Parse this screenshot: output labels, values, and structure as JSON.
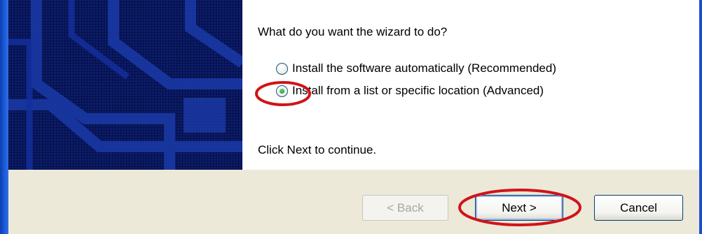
{
  "wizard": {
    "prompt": "What do you want the wizard to do?",
    "options": [
      {
        "label": "Install the software automatically (Recommended)",
        "checked": false
      },
      {
        "label": "Install from a list or specific location (Advanced)",
        "checked": true
      }
    ],
    "continue_text": "Click Next to continue."
  },
  "buttons": {
    "back_label": "< Back",
    "next_label": "Next >",
    "cancel_label": "Cancel"
  },
  "colors": {
    "annotation": "#d0141a",
    "panel": "#0b1c6e",
    "button_bar": "#ece9d8"
  }
}
